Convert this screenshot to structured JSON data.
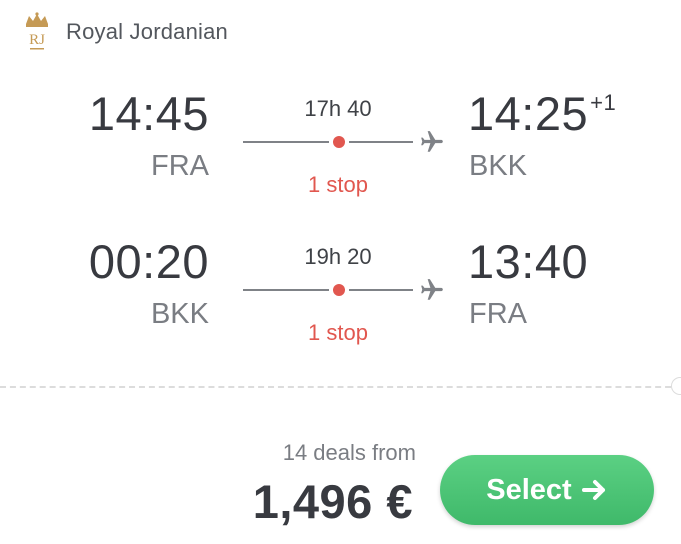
{
  "airline": {
    "name": "Royal Jordanian",
    "logo_icon": "crown-logo-icon",
    "logo_text": "RJ",
    "logo_color": "#c59a55"
  },
  "legs": [
    {
      "departure_time": "14:45",
      "departure_code": "FRA",
      "duration": "17h 40",
      "stops": "1 stop",
      "arrival_time": "14:25",
      "arrival_day_offset": "+1",
      "arrival_code": "BKK"
    },
    {
      "departure_time": "00:20",
      "departure_code": "BKK",
      "duration": "19h 20",
      "stops": "1 stop",
      "arrival_time": "13:40",
      "arrival_day_offset": "",
      "arrival_code": "FRA"
    }
  ],
  "pricing": {
    "deals_label": "14 deals from",
    "price": "1,496 €"
  },
  "select_button": {
    "label": "Select",
    "icon": "arrow-right-icon"
  },
  "colors": {
    "stop_red": "#e1574f",
    "button_green": "#4cc575",
    "text_dark": "#383a40",
    "text_muted": "#7a7d83"
  }
}
